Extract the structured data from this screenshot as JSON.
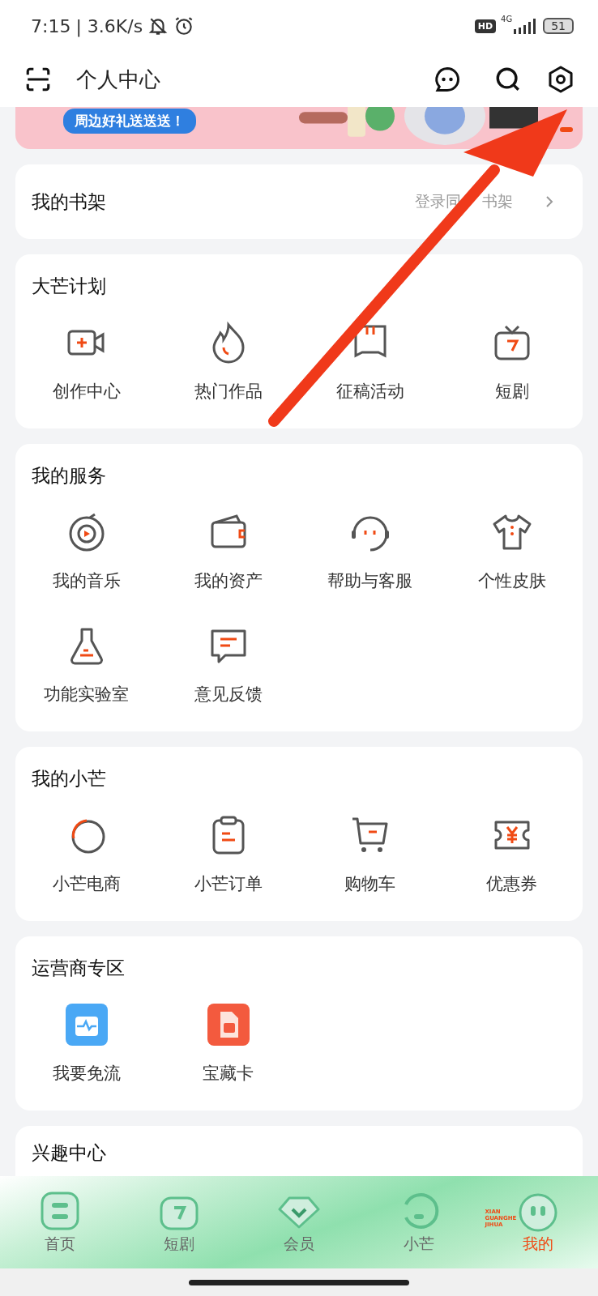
{
  "status_bar": {
    "time": "7:15",
    "speed": "| 3.6K/s",
    "hd": "HD",
    "network": "4G",
    "battery": "51"
  },
  "header": {
    "title": "个人中心"
  },
  "banner": {
    "tag": "周边好礼送送送！"
  },
  "bookshelf": {
    "title": "我的书架",
    "hint_parts": [
      "登录同",
      "书架"
    ]
  },
  "sections": [
    {
      "title": "大芒计划",
      "items": [
        "创作中心",
        "热门作品",
        "征稿活动",
        "短剧"
      ]
    },
    {
      "title": "我的服务",
      "items": [
        "我的音乐",
        "我的资产",
        "帮助与客服",
        "个性皮肤",
        "功能实验室",
        "意见反馈"
      ]
    },
    {
      "title": "我的小芒",
      "items": [
        "小芒电商",
        "小芒订单",
        "购物车",
        "优惠券"
      ]
    },
    {
      "title": "运营商专区",
      "items": [
        "我要免流",
        "宝藏卡"
      ]
    }
  ],
  "partial_section": {
    "title": "兴趣中心"
  },
  "bottom_nav": [
    {
      "label": "首页",
      "selected": false
    },
    {
      "label": "短剧",
      "selected": false
    },
    {
      "label": "会员",
      "selected": false
    },
    {
      "label": "小芒",
      "selected": false
    },
    {
      "label": "我的",
      "selected": true,
      "badge": "XIAN GUANGHE JIHUA"
    }
  ]
}
